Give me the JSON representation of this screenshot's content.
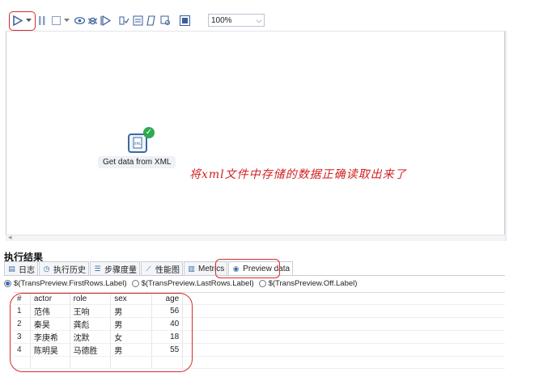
{
  "toolbar": {
    "icons": [
      "run-icon",
      "run-dropdown-icon",
      "pause-icon",
      "stop-icon",
      "stop-dropdown-icon",
      "preview-icon",
      "debug-icon",
      "replay-icon",
      "verify-icon",
      "impact-icon",
      "sql-icon",
      "explore-db-icon",
      "show-results-icon"
    ],
    "zoom": "100%"
  },
  "canvas": {
    "step_label": "Get data from XML",
    "annotation": "将xml文件中存储的数据正确读取出来了"
  },
  "results": {
    "title": "执行结果",
    "tabs": [
      "日志",
      "执行历史",
      "步骤度量",
      "性能图",
      "Metrics",
      "Preview data"
    ],
    "radios": [
      "$(TransPreview.FirstRows.Label)",
      "$(TransPreview.LastRows.Label)",
      "$(TransPreview.Off.Label)"
    ],
    "columns": [
      "#",
      "actor",
      "role",
      "sex",
      "age"
    ],
    "rows": [
      [
        "1",
        "范伟",
        "王响",
        "男",
        "56"
      ],
      [
        "2",
        "秦昊",
        "龚彪",
        "男",
        "40"
      ],
      [
        "3",
        "李庚希",
        "沈默",
        "女",
        "18"
      ],
      [
        "4",
        "陈明昊",
        "马德胜",
        "男",
        "55"
      ]
    ]
  }
}
